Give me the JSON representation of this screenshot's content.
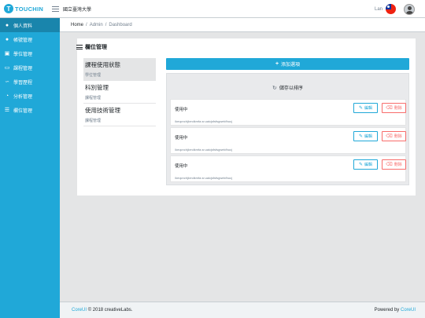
{
  "header": {
    "brand_letter": "T",
    "brand_text": "TOUCHIN",
    "org": "國立臺灣大學",
    "user": "Lan",
    "flag_icon": "taiwan-flag-icon",
    "avatar_icon": "user-avatar-icon"
  },
  "sidebar": {
    "items": [
      {
        "label": "個人資料",
        "icon": "user-icon",
        "glyph": "👤"
      },
      {
        "label": "帳號管理",
        "icon": "users-icon",
        "glyph": "👥"
      },
      {
        "label": "學位管理",
        "icon": "sitemap-icon",
        "glyph": "⛶"
      },
      {
        "label": "課程管理",
        "icon": "display-icon",
        "glyph": "🖵"
      },
      {
        "label": "學習歷程",
        "icon": "chart-icon",
        "glyph": "📈"
      },
      {
        "label": "分析管理",
        "icon": "pie-icon",
        "glyph": "◔"
      },
      {
        "label": "欄位管理",
        "icon": "list-icon",
        "glyph": "☰"
      }
    ]
  },
  "breadcrumb": [
    "Home",
    "Admin",
    "Dashboard"
  ],
  "card": {
    "title": "欄位管理"
  },
  "left_list": [
    {
      "title": "課程使用狀態",
      "subtitle": "學位管理"
    },
    {
      "title": "科別管理",
      "subtitle": "課程管理"
    },
    {
      "title": "使用技術管理",
      "subtitle": "課程管理"
    }
  ],
  "add_button": "添加選項",
  "reorder_label": "儲存以排序",
  "rows": [
    {
      "status": "使用中",
      "path": "/keqcnchjkrndkmfa.sr.uaicjsfsfsgwekfhucj",
      "edit": "編輯",
      "delete": "刪除"
    },
    {
      "status": "使用中",
      "path": "/keqcnchjkrndkmfa.sr.uaicjsfsfsgwekfhucj",
      "edit": "編輯",
      "delete": "刪除"
    },
    {
      "status": "使用中",
      "path": "/keqcnchjkrndkmfa.sr.uaicjsfsfsgwekfhucj",
      "edit": "編輯",
      "delete": "刪除"
    }
  ],
  "footer": {
    "brand_link": "CoreUI",
    "copyright": "© 2018 creativeLabs.",
    "powered_by": "Powered by",
    "powered_link": "CoreUI"
  },
  "colors": {
    "primary": "#20a8d8",
    "primary_dark": "#1985ac",
    "danger": "#f86c6b",
    "background": "#e4e5e6"
  }
}
